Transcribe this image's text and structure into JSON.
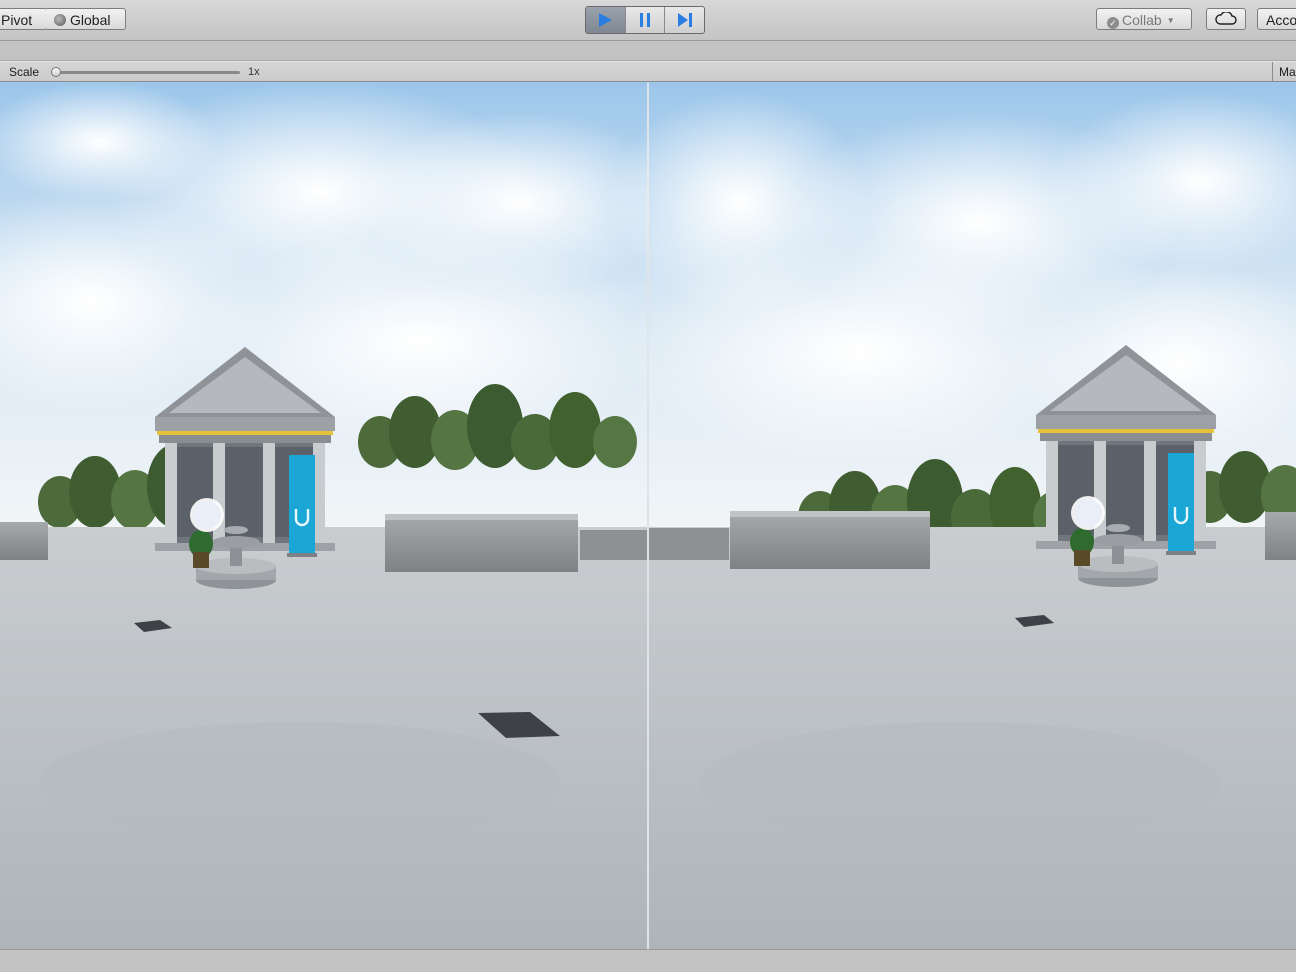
{
  "toolbar": {
    "pivot_label": "Pivot",
    "global_label": "Global",
    "global_icon": "globe-icon",
    "play_controls": [
      {
        "name": "play",
        "icon": "play-icon",
        "active": true
      },
      {
        "name": "pause",
        "icon": "pause-icon",
        "active": false
      },
      {
        "name": "step",
        "icon": "step-icon",
        "active": false
      }
    ],
    "collab_label": "Collab",
    "collab_icon": "check-circle-icon",
    "cloud_icon": "cloud-icon",
    "account_label": "Acco"
  },
  "game_view": {
    "scale_label": "Scale",
    "scale_value_label": "1x",
    "scale_value": 1,
    "maximize_label": "Ma"
  },
  "scene": {
    "mode": "stereo",
    "banner_icon": "udacity-logo",
    "colors": {
      "sky": "#cfe1f1",
      "ground": "#b8bec3",
      "banner": "#1aa7d6",
      "accent_trim": "#e4c23c",
      "active_play": "#2a7de1"
    }
  }
}
